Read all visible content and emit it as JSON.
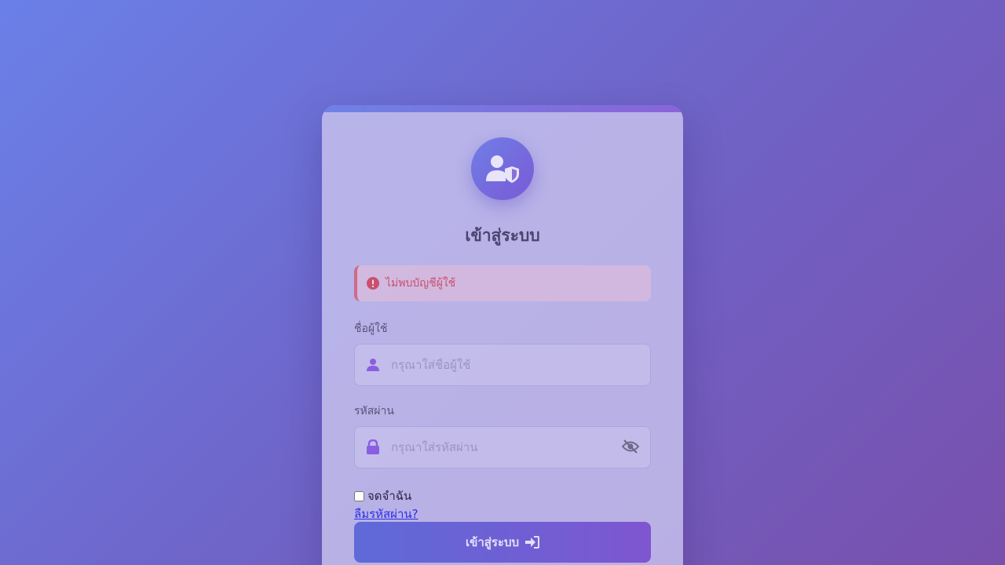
{
  "login": {
    "title": "เข้าสู่ระบบ",
    "error_message": "ไม่พบบัญชีผู้ใช้",
    "username": {
      "label": "ชื่อผู้ใช้",
      "placeholder": "กรุณาใส่ชื่อผู้ใช้",
      "value": ""
    },
    "password": {
      "label": "รหัสผ่าน",
      "placeholder": "กรุณาใส่รหัสผ่าน",
      "value": ""
    },
    "remember_label": "จดจำฉัน",
    "forgot_label": "ลืมรหัสผ่าน?",
    "submit_label": "เข้าสู่ระบบ"
  },
  "icons": {
    "avatar": "user-shield-icon",
    "alert": "exclamation-circle-icon",
    "username": "user-icon",
    "password": "lock-icon",
    "toggle": "eye-slash-icon",
    "submit": "sign-in-icon"
  },
  "colors": {
    "accent": "#7a5ad6",
    "error": "#c8506e",
    "link": "#2a2fe8"
  }
}
